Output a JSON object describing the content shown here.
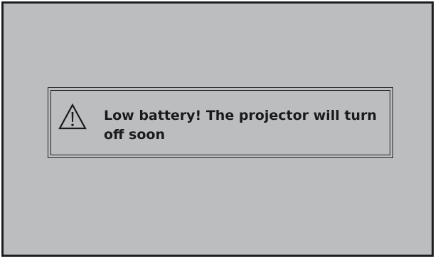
{
  "dialog": {
    "message": "Low battery! The projector will turn off soon",
    "icon": "warning-triangle-icon"
  },
  "colors": {
    "screen_background": "#bcbdbf",
    "border": "#1e1e1e",
    "text": "#1a1a1a"
  }
}
